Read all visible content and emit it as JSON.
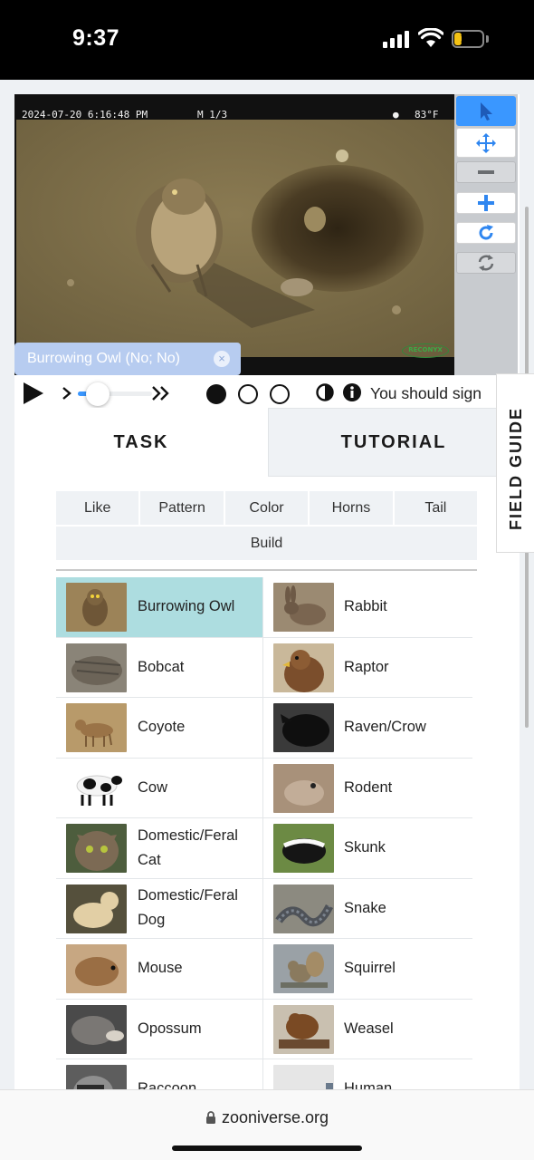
{
  "status_bar": {
    "time": "9:37",
    "battery": "17"
  },
  "viewer": {
    "timestamp": "2024-07-20 6:16:48 PM",
    "frame": "M 1/3",
    "temperature": "83°F",
    "camera_brand": "RECONYX",
    "mark_tag": "Burrowing Owl (No; No)",
    "toolbar": [
      "pointer-icon",
      "move-icon",
      "zoom-out-icon",
      "zoom-in-icon",
      "rotate-icon",
      "reset-icon"
    ]
  },
  "controls": {
    "notice": "You should sign"
  },
  "tabs": {
    "task": "TASK",
    "tutorial": "TUTORIAL"
  },
  "field_guide": "FIELD GUIDE",
  "filters": [
    "Like",
    "Pattern",
    "Color",
    "Horns",
    "Tail",
    "Build"
  ],
  "choices": [
    "Burrowing Owl",
    "Rabbit",
    "Bobcat",
    "Raptor",
    "Coyote",
    "Raven/Crow",
    "Cow",
    "Rodent",
    "Domestic/Feral Cat",
    "Skunk",
    "Domestic/Feral Dog",
    "Snake",
    "Mouse",
    "Squirrel",
    "Opossum",
    "Weasel",
    "Raccoon",
    "Human"
  ],
  "selected_choice": "Burrowing Owl",
  "browser": {
    "url": "zooniverse.org"
  },
  "colors": {
    "accent_blue": "#3a97ff",
    "selected_bg": "#addde0",
    "tag_bg": "#b7ccf0"
  }
}
